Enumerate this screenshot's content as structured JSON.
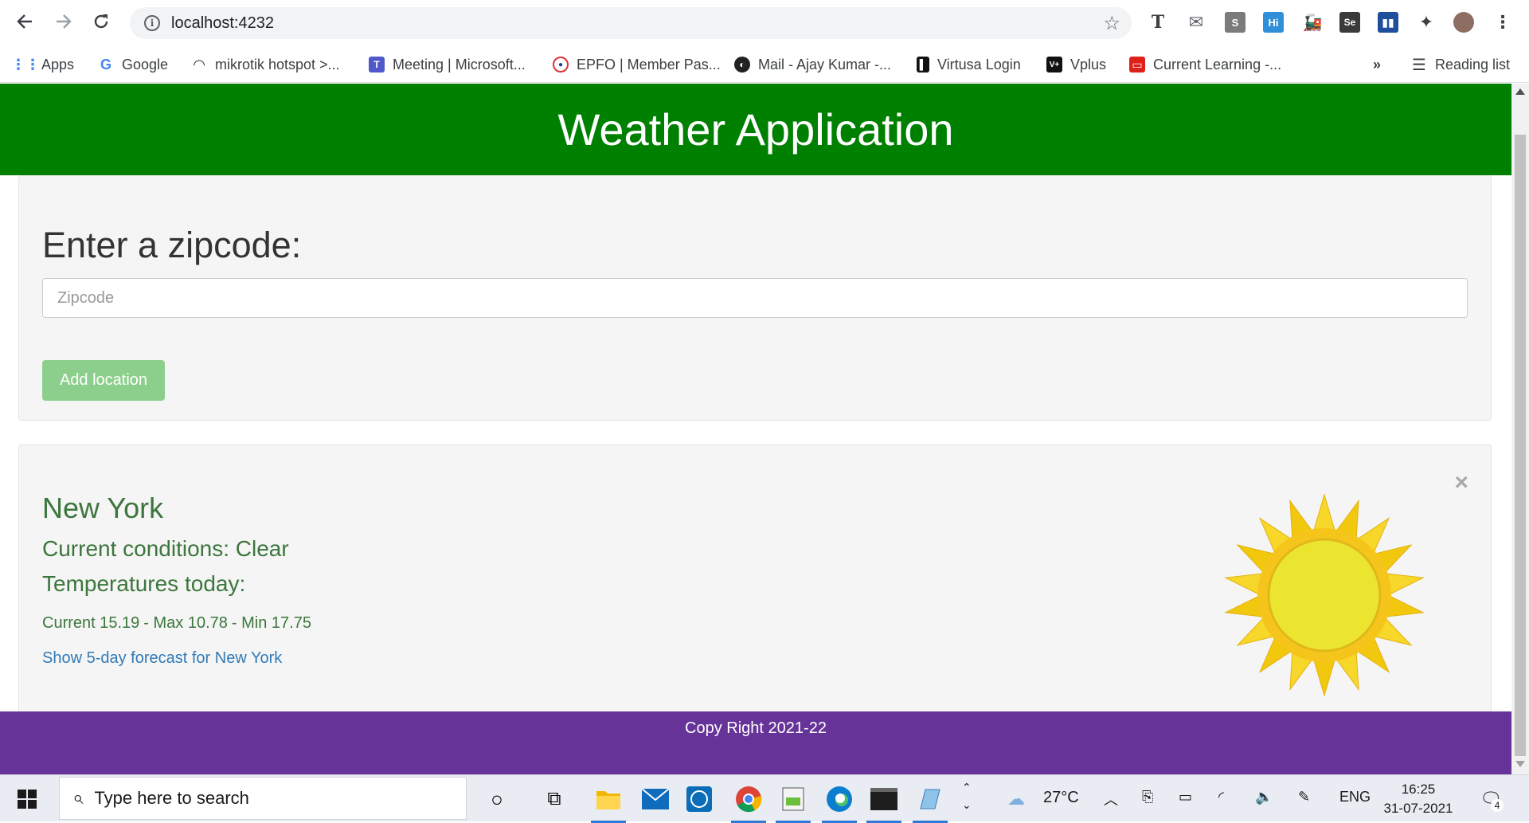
{
  "browser": {
    "url": "localhost:4232",
    "bookmarks": [
      {
        "label": "Apps",
        "icon": "apps-grid-icon"
      },
      {
        "label": "Google",
        "icon": "google-icon"
      },
      {
        "label": "mikrotik hotspot >...",
        "icon": "mikrotik-icon"
      },
      {
        "label": "Meeting | Microsoft...",
        "icon": "teams-icon"
      },
      {
        "label": "EPFO | Member Pas...",
        "icon": "epfo-icon"
      },
      {
        "label": "Mail - Ajay Kumar -...",
        "icon": "globe-icon"
      },
      {
        "label": "Virtusa Login",
        "icon": "virtusa-icon"
      },
      {
        "label": "Vplus",
        "icon": "vplus-icon"
      },
      {
        "label": "Current Learning -...",
        "icon": "oracle-icon"
      }
    ],
    "more": "»",
    "reading_list": "Reading list"
  },
  "app": {
    "title": "Weather Application",
    "zip_label": "Enter a zipcode:",
    "zip_placeholder": "Zipcode",
    "add_button": "Add location"
  },
  "location": {
    "city": "New York",
    "conditions": "Current conditions: Clear",
    "temps_heading": "Temperatures today:",
    "current": "Current 15.19",
    "max": "- Max 10.78",
    "min": "- Min 17.75",
    "forecast_link": "Show 5-day forecast for New York",
    "close": "×",
    "weather_icon": "sun-icon"
  },
  "footer": {
    "text": "Copy Right 2021-22"
  },
  "taskbar": {
    "search_placeholder": "Type here to search",
    "weather": "27°C",
    "language": "ENG",
    "time": "16:25",
    "date": "31-07-2021",
    "notifications": "4"
  },
  "colors": {
    "header": "#008000",
    "footer": "#663399",
    "text_green": "#3c763d",
    "link": "#337ab7"
  }
}
